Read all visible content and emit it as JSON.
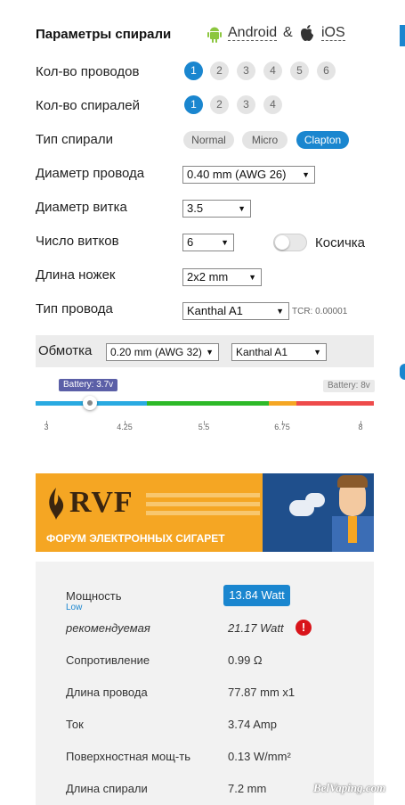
{
  "header": {
    "title": "Параметры спирали",
    "android_label": "Android",
    "amp": "&",
    "ios_label": "iOS"
  },
  "wires": {
    "label": "Кол-во проводов",
    "options": [
      "1",
      "2",
      "3",
      "4",
      "5",
      "6"
    ],
    "selected": "1"
  },
  "coils": {
    "label": "Кол-во спиралей",
    "options": [
      "1",
      "2",
      "3",
      "4"
    ],
    "selected": "1"
  },
  "coil_type": {
    "label": "Тип спирали",
    "options": [
      "Normal",
      "Micro",
      "Clapton"
    ],
    "selected": "Clapton"
  },
  "wire_diameter": {
    "label": "Диаметр провода",
    "value": "0.40 mm (AWG 26)"
  },
  "inner_diameter": {
    "label": "Диаметр витка",
    "value": "3.5"
  },
  "wraps": {
    "label": "Число витков",
    "value": "6",
    "toggle_label": "Косичка"
  },
  "legs": {
    "label": "Длина ножек",
    "value": "2x2 mm"
  },
  "wire_type": {
    "label": "Тип провода",
    "value": "Kanthal A1",
    "tcr": "TCR: 0.00001"
  },
  "winding": {
    "label": "Обмотка",
    "diameter": "0.20 mm (AWG 32)",
    "material": "Kanthal A1"
  },
  "battery": {
    "current_label": "Battery: 3.7v",
    "max_label": "Battery: 8v",
    "ticks": [
      "3",
      "4.25",
      "5.5",
      "6.75",
      "8"
    ],
    "min": 3,
    "max": 8,
    "value": 3.7,
    "colors": {
      "blue": "#29aae1",
      "green": "#2db928",
      "orange": "#f5a623",
      "red": "#ee4b4b",
      "accent": "#1a86cf"
    }
  },
  "banner": {
    "logo": "RVF",
    "caption": "ФОРУМ ЭЛЕКТРОННЫХ СИГАРЕТ"
  },
  "results": {
    "power_label": "Мощность",
    "power_value": "13.84 Watt",
    "power_status": "Low",
    "recommended_label": "рекомендуемая",
    "recommended_value": "21.17 Watt",
    "resistance_label": "Сопротивление",
    "resistance_value": "0.99 Ω",
    "wire_length_label": "Длина провода",
    "wire_length_value": "77.87 mm x1",
    "current_label": "Ток",
    "current_value": "3.74 Amp",
    "surface_label": "Поверхностная мощ-ть",
    "surface_value": "0.13 W/mm²",
    "coil_length_label": "Длина спирали",
    "coil_length_value": "7.2 mm"
  },
  "watermark": "BelVaping.com"
}
